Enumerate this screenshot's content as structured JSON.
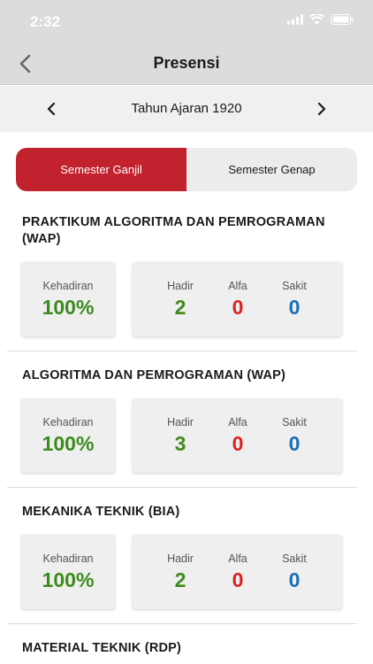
{
  "status_bar": {
    "time": "2:32"
  },
  "header": {
    "title": "Presensi"
  },
  "year_selector": {
    "label": "Tahun Ajaran 1920"
  },
  "tabs": [
    {
      "label": "Semester Ganjil",
      "active": true
    },
    {
      "label": "Semester Genap",
      "active": false
    }
  ],
  "labels": {
    "kehadiran": "Kehadiran",
    "hadir": "Hadir",
    "alfa": "Alfa",
    "sakit": "Sakit"
  },
  "courses": [
    {
      "title": "PRAKTIKUM ALGORITMA DAN PEMROGRAMAN (WAP)",
      "kehadiran": "100%",
      "hadir": "2",
      "alfa": "0",
      "sakit": "0"
    },
    {
      "title": "ALGORITMA DAN PEMROGRAMAN (WAP)",
      "kehadiran": "100%",
      "hadir": "3",
      "alfa": "0",
      "sakit": "0"
    },
    {
      "title": "MEKANIKA TEKNIK (BIA)",
      "kehadiran": "100%",
      "hadir": "2",
      "alfa": "0",
      "sakit": "0"
    },
    {
      "title": "MATERIAL TEKNIK (RDP)"
    }
  ],
  "colors": {
    "accent": "#c1222d",
    "hadir": "#3e8a1c",
    "alfa": "#d92323",
    "sakit": "#1b6fb5"
  }
}
